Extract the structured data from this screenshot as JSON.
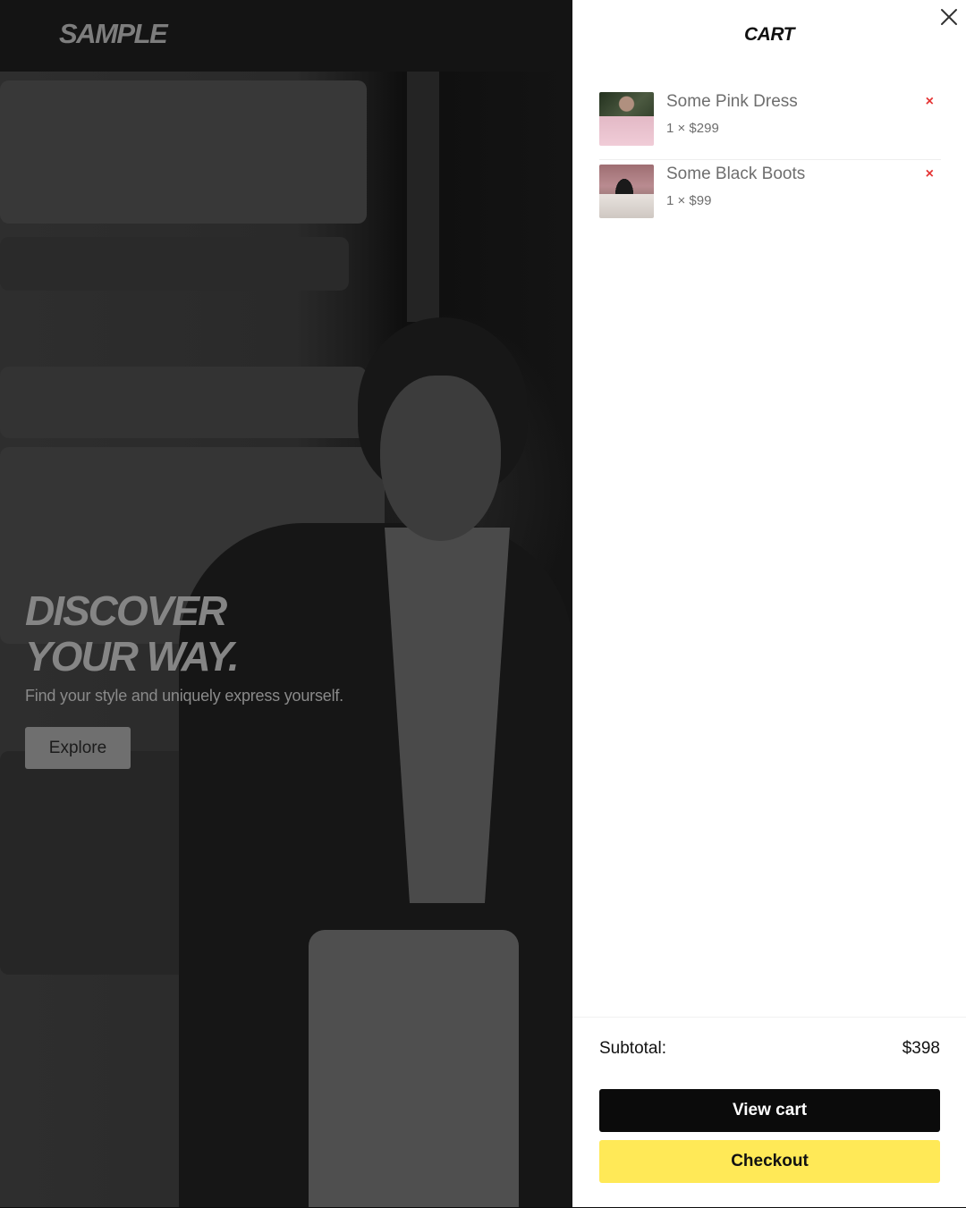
{
  "site": {
    "logo": "SAMPLE"
  },
  "hero": {
    "title_line1": "DISCOVER",
    "title_line2": "YOUR WAY.",
    "subtitle": "Find your style and uniquely express yourself.",
    "cta_label": "Explore"
  },
  "cart": {
    "title": "CART",
    "close_icon": "close-icon",
    "items": [
      {
        "name": "Some Pink Dress",
        "meta": "1 × $299",
        "quantity": 1,
        "price": "$299",
        "thumb_icon": "product-thumbnail",
        "remove_glyph": "×"
      },
      {
        "name": "Some Black Boots",
        "meta": "1 × $99",
        "quantity": 1,
        "price": "$99",
        "thumb_icon": "product-thumbnail",
        "remove_glyph": "×"
      }
    ],
    "subtotal_label": "Subtotal:",
    "subtotal_value": "$398",
    "view_cart_label": "View cart",
    "checkout_label": "Checkout"
  },
  "colors": {
    "overlay": "#0c0c0c",
    "accent_yellow": "#ffe957",
    "remove_red": "#e53535",
    "view_cart_bg": "#0b0b0b"
  }
}
